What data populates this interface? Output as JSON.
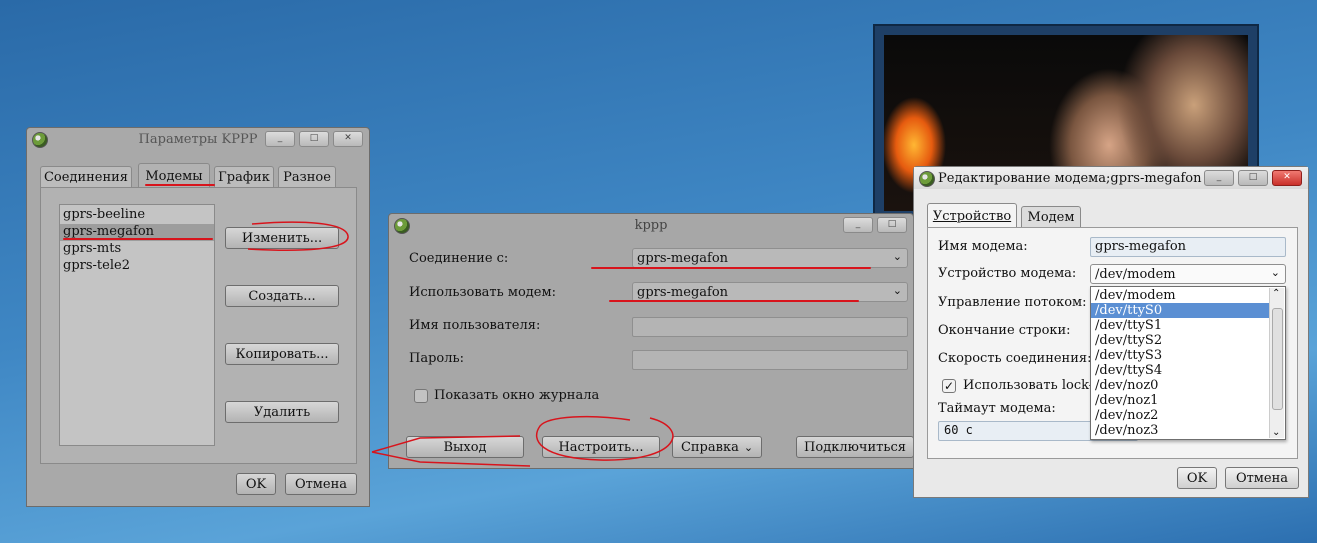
{
  "colors": {
    "desktop": "#3f87c4",
    "selection": "#5b8fd3",
    "annotation": "#d8141c",
    "close_active": "#c9302a"
  },
  "window_buttons": {
    "minimize": "_",
    "maximize": "□",
    "close": "✕"
  },
  "kppp_settings": {
    "title": "Параметры KPPP",
    "tabs": [
      "Соединения",
      "Модемы",
      "График",
      "Разное"
    ],
    "modems": [
      "gprs-beeline",
      "gprs-megafon",
      "gprs-mts",
      "gprs-tele2"
    ],
    "buttons": {
      "edit": "Изменить...",
      "create": "Создать...",
      "copy": "Копировать...",
      "delete": "Удалить"
    },
    "ok": "OK",
    "cancel": "Отмена"
  },
  "kppp_main": {
    "title": "kppp",
    "connection_label": "Соединение с:",
    "connection_value": "gprs-megafon",
    "modem_label": "Использовать модем:",
    "modem_value": "gprs-megafon",
    "username_label": "Имя пользователя:",
    "password_label": "Пароль:",
    "show_log_label": "Показать окно журнала",
    "buttons": {
      "exit": "Выход",
      "setup": "Настроить...",
      "help": "Справка",
      "connect": "Подключиться"
    }
  },
  "modem_edit": {
    "title": "Редактирование модема;gprs-megafon –",
    "tabs": [
      "Устройство",
      "Модем"
    ],
    "modem_name_label": "Имя модема:",
    "modem_name_value": "gprs-megafon",
    "device_label": "Устройство модема:",
    "device_value": "/dev/modem",
    "flow_label": "Управление потоком:",
    "line_end_label": "Окончание строки:",
    "speed_label": "Скорость соединения:",
    "lock_label": "Использовать lock-ф",
    "timeout_label": "Таймаут модема:",
    "timeout_value": "60 с",
    "dropdown_options": [
      "/dev/modem",
      "/dev/ttyS0",
      "/dev/ttyS1",
      "/dev/ttyS2",
      "/dev/ttyS3",
      "/dev/ttyS4",
      "/dev/noz0",
      "/dev/noz1",
      "/dev/noz2",
      "/dev/noz3"
    ],
    "highlighted_option": "/dev/ttyS0",
    "ok": "OK",
    "cancel": "Отмена"
  }
}
